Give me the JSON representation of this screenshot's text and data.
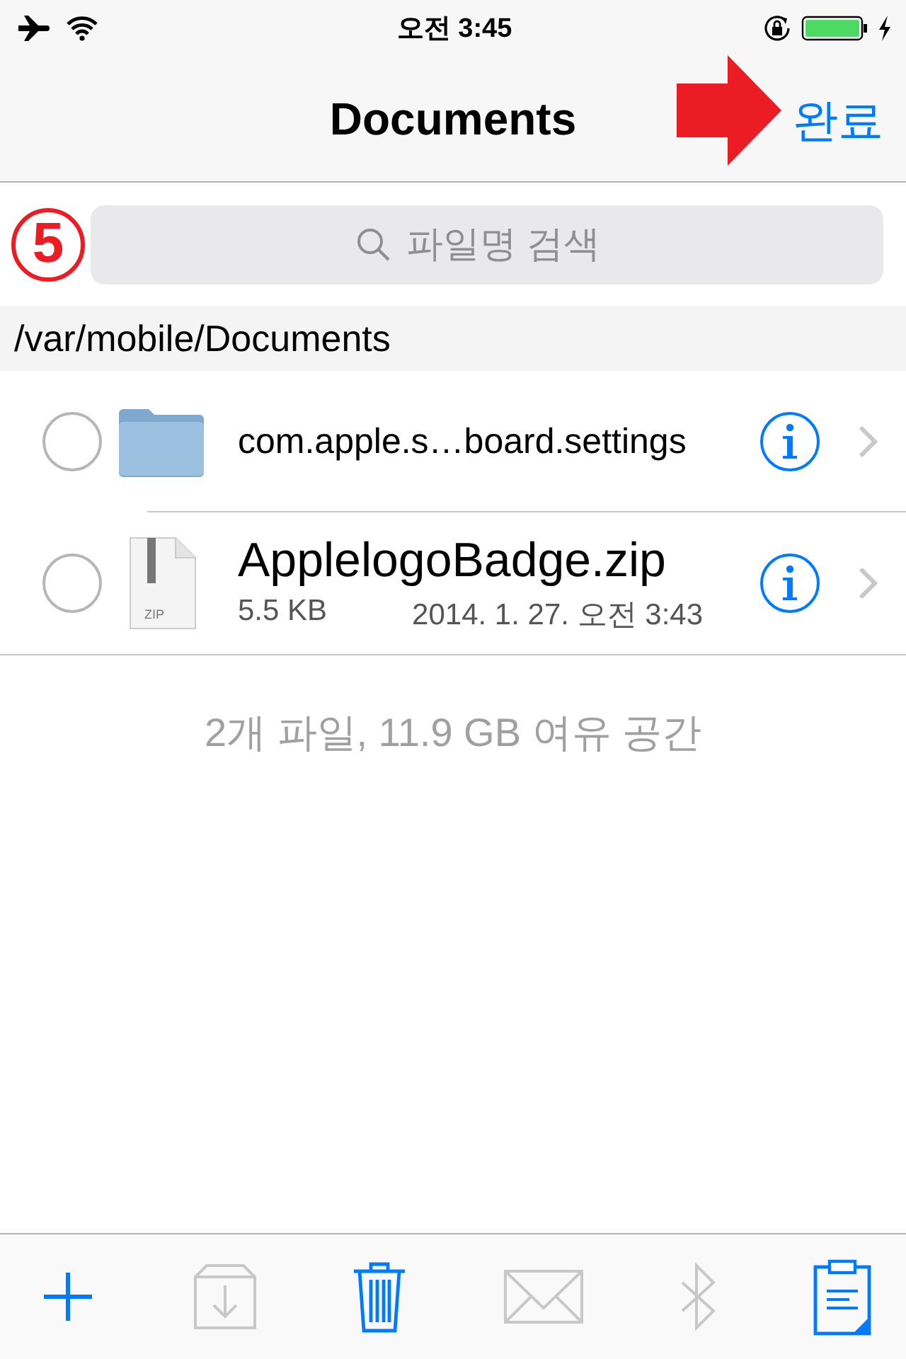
{
  "status_bar": {
    "time": "오전 3:45"
  },
  "nav": {
    "title": "Documents",
    "done": "완료"
  },
  "annotation": {
    "marker": "5"
  },
  "search": {
    "placeholder": "파일명 검색"
  },
  "path": "/var/mobile/Documents",
  "files": [
    {
      "kind": "folder",
      "name": "com.apple.s…board.settings",
      "selected": false
    },
    {
      "kind": "zip",
      "icon_label": "ZIP",
      "name": "ApplelogoBadge.zip",
      "size": "5.5 KB",
      "date": "2014. 1. 27. 오전 3:43",
      "selected": false
    }
  ],
  "footer": "2개 파일, 11.9 GB 여유 공간",
  "toolbar": [
    {
      "kind": "add",
      "disabled": false
    },
    {
      "kind": "extract",
      "disabled": true
    },
    {
      "kind": "trash",
      "disabled": false
    },
    {
      "kind": "mail",
      "disabled": true
    },
    {
      "kind": "bluetooth",
      "disabled": true
    },
    {
      "kind": "clipboard",
      "disabled": false
    }
  ]
}
